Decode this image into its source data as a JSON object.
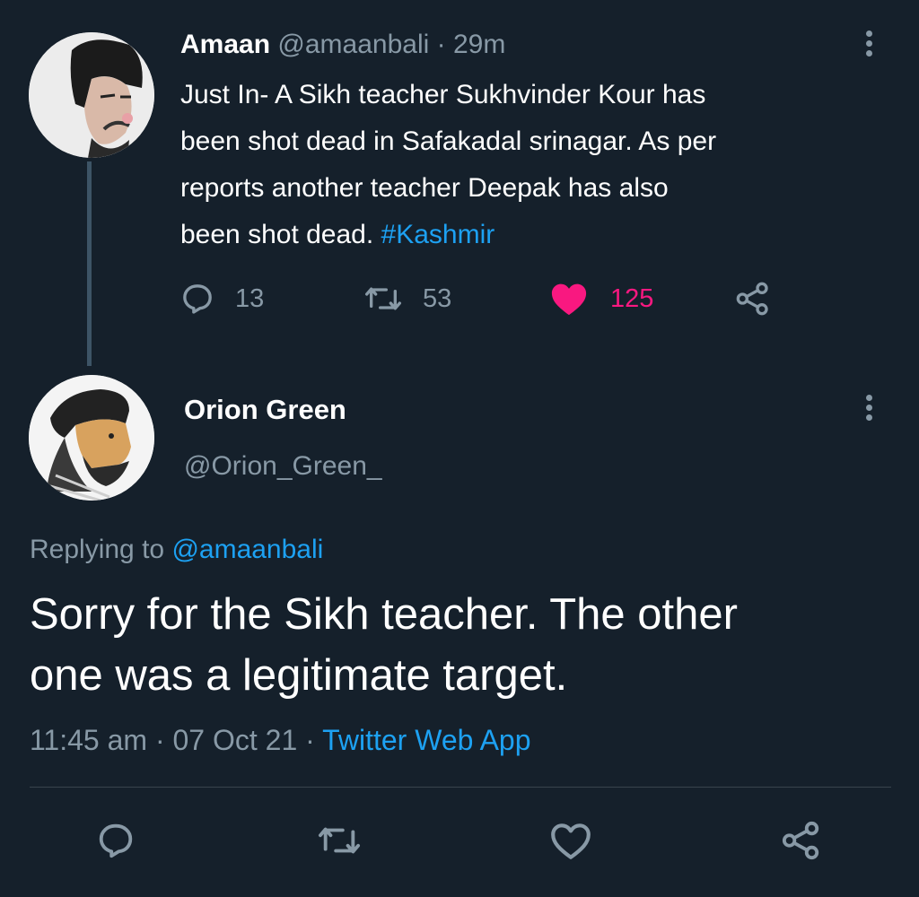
{
  "tweet": {
    "name": "Amaan",
    "handle": "@amaanbali",
    "separator": " · ",
    "time": "29m",
    "body_lines": [
      "Just In- A Sikh teacher Sukhvinder Kour has",
      "been shot dead in Safakadal srinagar. As per",
      "reports another teacher Deepak has also",
      "been shot dead. "
    ],
    "hashtag": "#Kashmir",
    "replies": "13",
    "retweets": "53",
    "likes": "125"
  },
  "reply": {
    "name": "Orion Green",
    "handle": "@Orion_Green_",
    "replying_prefix": "Replying to ",
    "replying_to": "@amaanbali",
    "body_lines": [
      "Sorry for the Sikh teacher. The other",
      "one was a legitimate target."
    ],
    "time": "11:45 am",
    "dot1": " · ",
    "date": "07 Oct 21",
    "dot2": " · ",
    "app": "Twitter Web App"
  },
  "colors": {
    "background": "#15202b",
    "secondary_text": "#8899a6",
    "link": "#1da1f2",
    "like": "#f91880"
  },
  "icons": [
    "more-icon",
    "reply-icon",
    "retweet-icon",
    "heart-filled-icon",
    "share-icon",
    "heart-outline-icon"
  ]
}
